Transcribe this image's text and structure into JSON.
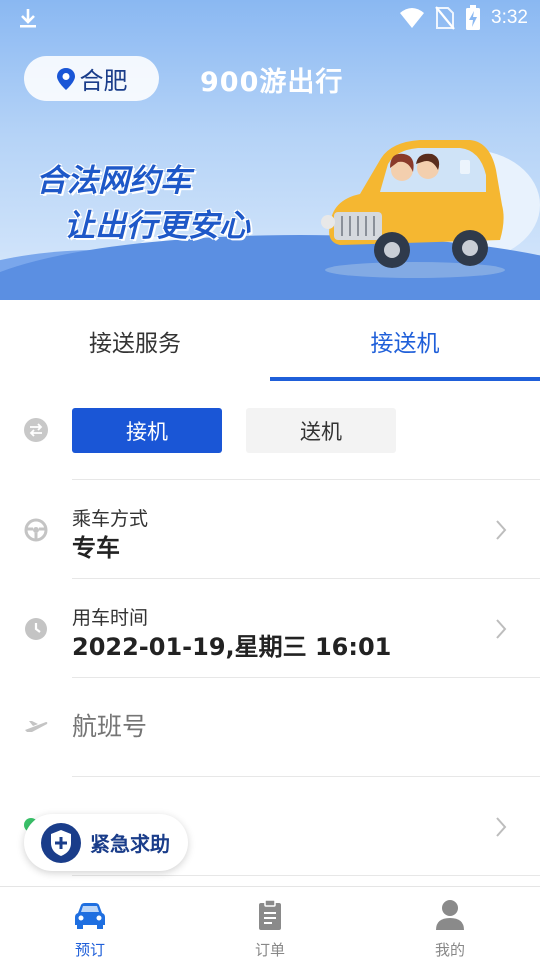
{
  "status_bar": {
    "time": "3:32",
    "icons": [
      "download-icon",
      "wifi-icon",
      "no-sim-icon",
      "battery-charging-icon"
    ]
  },
  "header": {
    "city": "合肥",
    "app_title": "900游出行",
    "slogan_line1": "合法网约车",
    "slogan_line2": "让出行更安心",
    "location_icon": "location-pin-icon"
  },
  "tabs": [
    {
      "label": "接送服务",
      "active": false
    },
    {
      "label": "接送机",
      "active": true
    }
  ],
  "colors": {
    "accent": "#1f5fd9",
    "primary_button": "#1a56d6",
    "placeholder": "#a8a8a8",
    "sos_indicator": "#3ac26a"
  },
  "form": {
    "mode_buttons": {
      "pickup": "接机",
      "dropoff": "送机",
      "selected": "pickup"
    },
    "ride_type": {
      "label": "乘车方式",
      "value": "专车"
    },
    "time": {
      "label": "用车时间",
      "value": "2022-01-19,星期三 16:01"
    },
    "flight": {
      "placeholder": "航班号"
    }
  },
  "sos": {
    "label": "紧急求助",
    "icon": "shield-plus-icon"
  },
  "bottom_nav": [
    {
      "label": "预订",
      "icon": "car-icon",
      "active": true
    },
    {
      "label": "订单",
      "icon": "clipboard-icon",
      "active": false
    },
    {
      "label": "我的",
      "icon": "person-icon",
      "active": false
    }
  ]
}
